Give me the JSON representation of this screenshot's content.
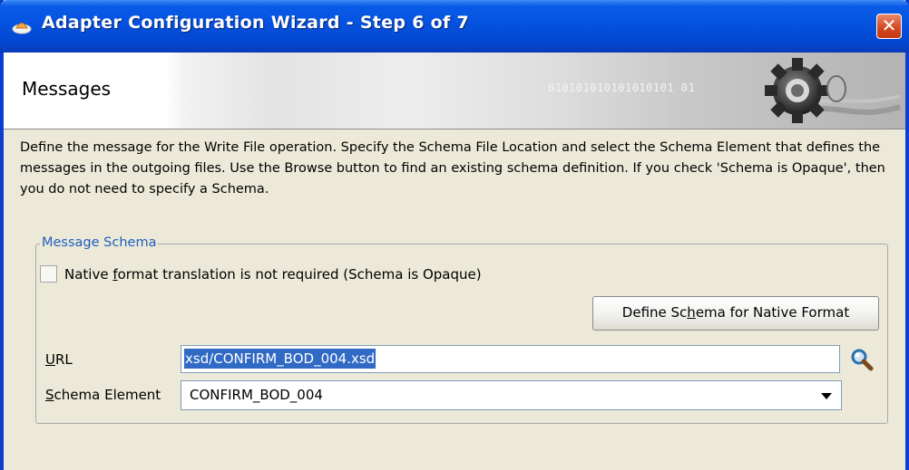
{
  "window": {
    "title": "Adapter Configuration Wizard - Step 6 of 7",
    "close_label": "✕"
  },
  "header": {
    "title": "Messages",
    "binary_text": "010101010101010101 01"
  },
  "description": "Define the message for the Write File operation.  Specify the Schema File Location and select the Schema Element that defines the messages in the outgoing files. Use the Browse button to find an existing schema definition. If you check 'Schema is Opaque', then you do not need to specify a Schema.",
  "message_schema": {
    "legend": "Message Schema",
    "opaque_checkbox": {
      "label_pre": "Native ",
      "label_mnemonic": "f",
      "label_post": "ormat translation is not required (Schema is Opaque)",
      "checked": false
    },
    "define_button": {
      "label_pre": "Define Sc",
      "label_mnemonic": "h",
      "label_post": "ema for Native Format"
    },
    "url": {
      "label_mnemonic": "U",
      "label_post": "RL",
      "value": "xsd/CONFIRM_BOD_004.xsd",
      "search_icon": "search-icon"
    },
    "schema_element": {
      "label_mnemonic": "S",
      "label_post": "chema Element",
      "value": "CONFIRM_BOD_004"
    }
  },
  "colors": {
    "titlebar": "#0552e0",
    "legend_text": "#1f5fbf",
    "selection": "#316ac5"
  }
}
